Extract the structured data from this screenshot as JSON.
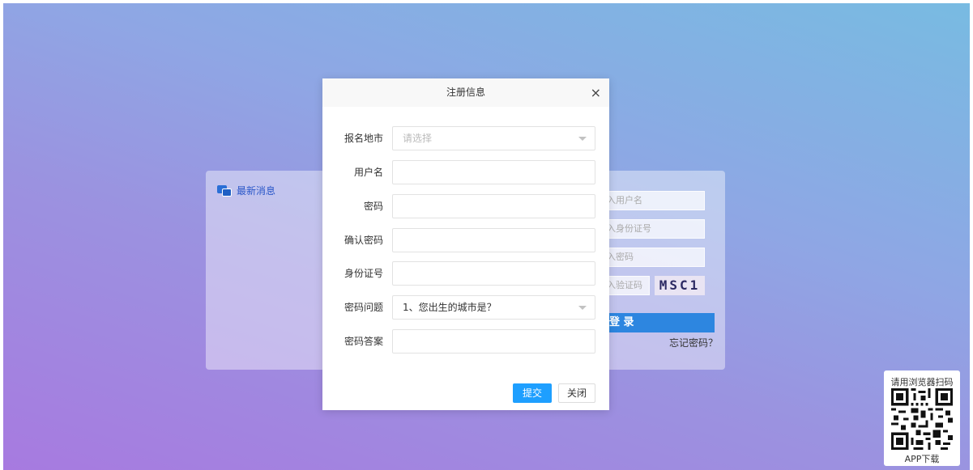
{
  "background": {
    "news": {
      "title": "最新消息"
    },
    "login": {
      "username_placeholder": "入用户名",
      "idcard_placeholder": "入身份证号",
      "password_placeholder": "入密码",
      "captcha_placeholder": "入验证码",
      "captcha_text": "MSC1",
      "login_label": "登 录",
      "forgot_label": "忘记密码？"
    }
  },
  "modal": {
    "title": "注册信息",
    "close_symbol": "×",
    "fields": [
      {
        "label": "报名地市",
        "value": "请选择",
        "type": "select",
        "placeholder": true
      },
      {
        "label": "用户名",
        "value": "",
        "type": "text"
      },
      {
        "label": "密码",
        "value": "",
        "type": "password"
      },
      {
        "label": "确认密码",
        "value": "",
        "type": "password"
      },
      {
        "label": "身份证号",
        "value": "",
        "type": "text"
      },
      {
        "label": "密码问题",
        "value": "1、您出生的城市是？",
        "type": "select",
        "placeholder": false
      },
      {
        "label": "密码答案",
        "value": "",
        "type": "text"
      }
    ],
    "submit_label": "提交",
    "close_label": "关闭"
  },
  "qr": {
    "top_text": "请用浏览器扫码",
    "bottom_text": "APP下载"
  },
  "colors": {
    "accent": "#1e9fff",
    "login_button": "#2d86e0",
    "news_title": "#2a57c9"
  }
}
